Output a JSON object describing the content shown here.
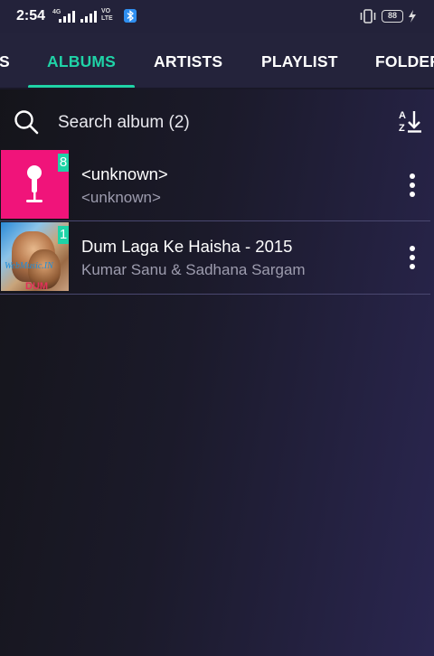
{
  "status_bar": {
    "time": "2:54",
    "network": "4G",
    "volte": "VO\nLTE",
    "battery": "88",
    "icons": [
      "signal-icon",
      "signal-icon",
      "volte-icon",
      "bluetooth-badge-icon",
      "vibrate-icon",
      "battery-icon",
      "charging-icon"
    ]
  },
  "tabs": [
    {
      "label": "S",
      "active": false
    },
    {
      "label": "ALBUMS",
      "active": true
    },
    {
      "label": "ARTISTS",
      "active": false
    },
    {
      "label": "PLAYLIST",
      "active": false
    },
    {
      "label": "FOLDER",
      "active": false
    }
  ],
  "search": {
    "placeholder": "Search album (2)",
    "icon": "search-icon",
    "sort_icon": "sort-az-icon"
  },
  "albums": [
    {
      "title": "<unknown>",
      "subtitle": "<unknown>",
      "count": "8",
      "thumb": "microphone-icon"
    },
    {
      "title": "Dum Laga Ke Haisha - 2015",
      "subtitle": "Kumar Sanu & Sadhana Sargam",
      "count": "1",
      "thumb": "album-art"
    }
  ],
  "colors": {
    "accent": "#1fd3a7",
    "tabbar": "#24233b",
    "pink_thumb": "#f0147a",
    "subtitle": "#9d9cae"
  }
}
